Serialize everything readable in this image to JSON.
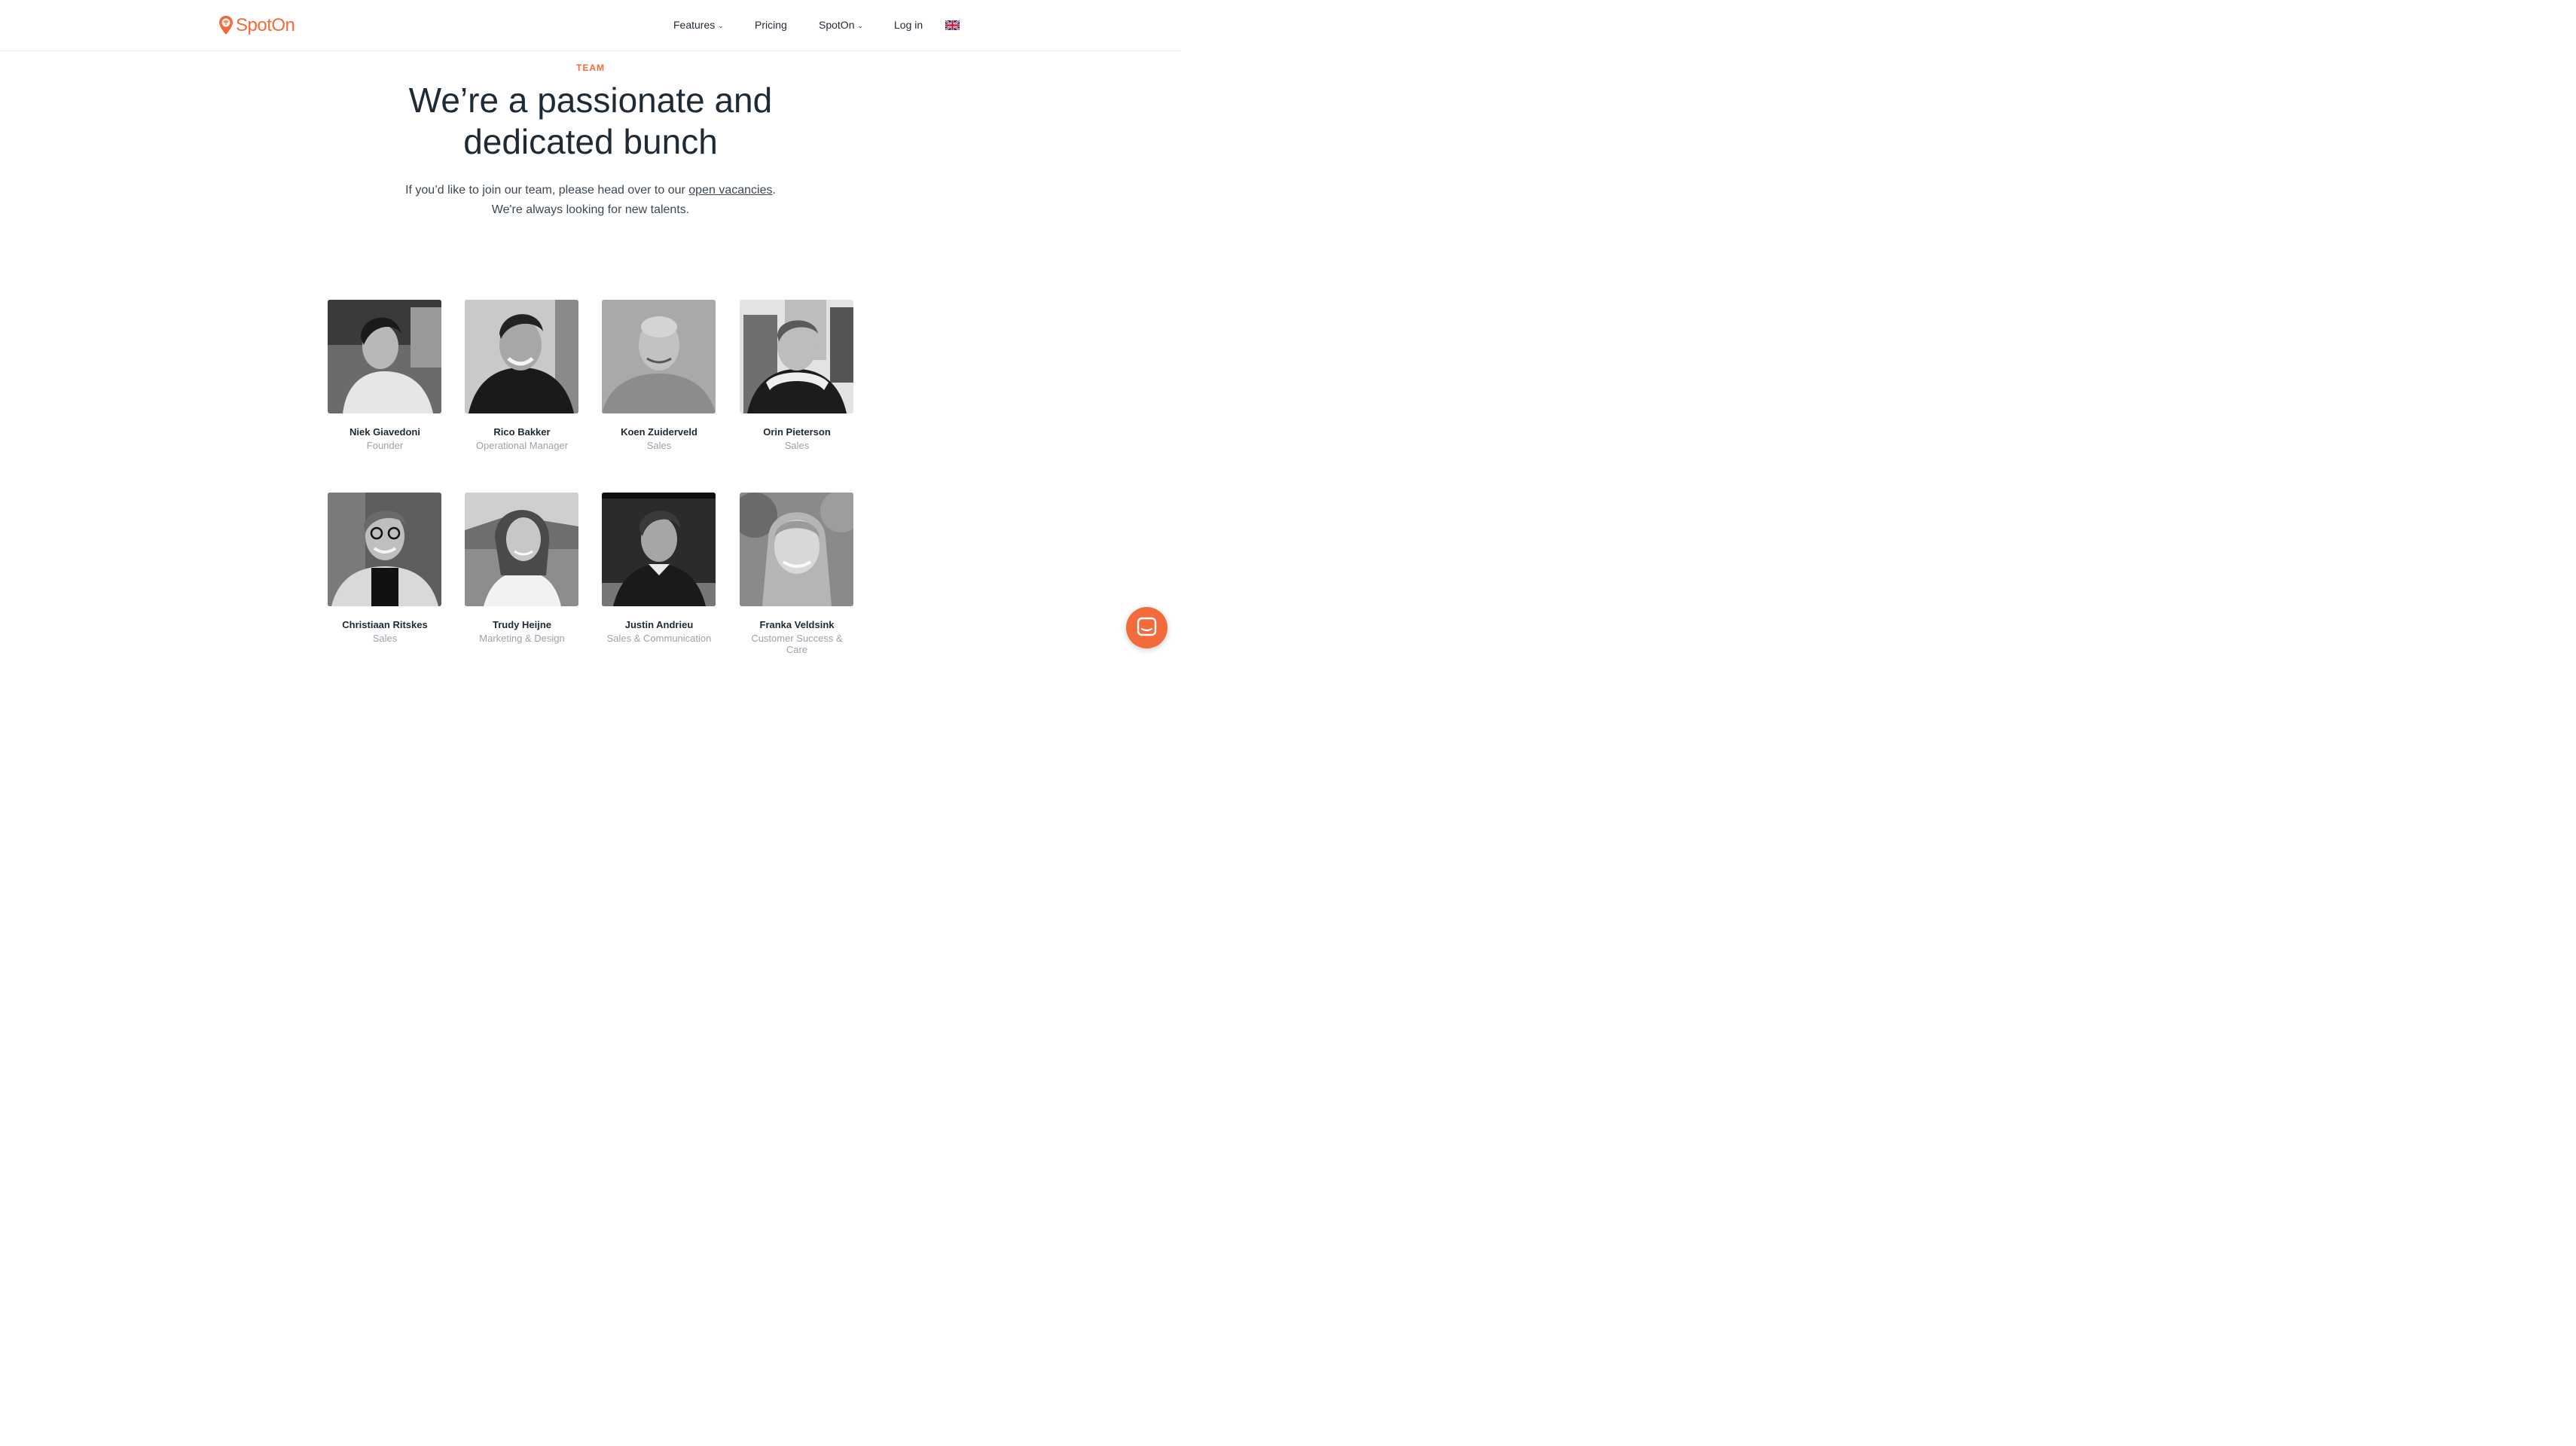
{
  "header": {
    "logo_text": "SpotOn",
    "nav": [
      {
        "label": "Features",
        "dropdown": true
      },
      {
        "label": "Pricing",
        "dropdown": false
      },
      {
        "label": "SpotOn",
        "dropdown": true
      },
      {
        "label": "Log in",
        "dropdown": false
      }
    ],
    "language_icon": "uk-flag-icon"
  },
  "hero": {
    "eyebrow": "TEAM",
    "title_line1": "We’re a passionate and",
    "title_line2": "dedicated bunch",
    "sub_before": "If you’d like to join our team, please head over to our ",
    "sub_link": "open vacancies",
    "sub_after": ".",
    "sub_line2": "We're always looking for new talents."
  },
  "team": [
    {
      "name": "Niek Giavedoni",
      "role": "Founder"
    },
    {
      "name": "Rico Bakker",
      "role": "Operational Manager"
    },
    {
      "name": "Koen Zuiderveld",
      "role": "Sales"
    },
    {
      "name": "Orin Pieterson",
      "role": "Sales"
    },
    {
      "name": "Christiaan Ritskes",
      "role": "Sales"
    },
    {
      "name": "Trudy Heijne",
      "role": "Marketing & Design"
    },
    {
      "name": "Justin Andrieu",
      "role": "Sales & Communication"
    },
    {
      "name": "Franka Veldsink",
      "role": "Customer Success & Care"
    }
  ],
  "colors": {
    "accent": "#f26b3a",
    "text": "#1e2a35",
    "muted": "#9aa3ab"
  },
  "chat_icon": "chat-bubble-icon"
}
